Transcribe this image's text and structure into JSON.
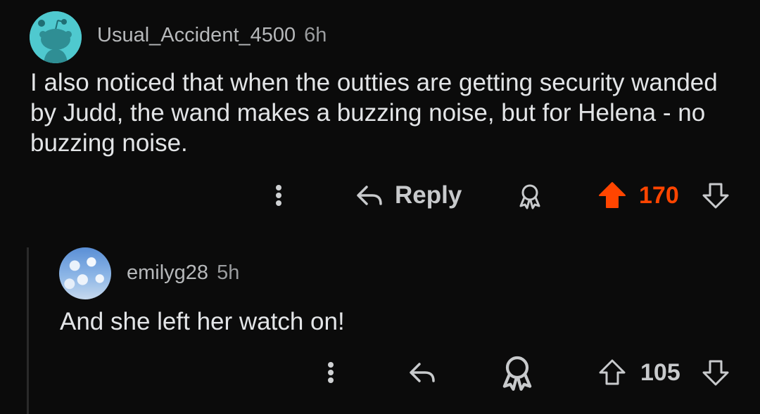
{
  "comments": [
    {
      "username": "Usual_Accident_4500",
      "time": "6h",
      "body": "I also noticed that when the outties are getting security wanded by Judd, the wand makes a buzzing noise, but for Helena - no buzzing noise.",
      "actions": {
        "more_icon": "more-vertical-icon",
        "reply_icon": "reply-arrow-icon",
        "reply_label": "Reply",
        "award_icon": "award-icon",
        "upvote_icon": "upvote-arrow-icon",
        "vote_count": "170",
        "downvote_icon": "downvote-arrow-icon",
        "upvote_active": true,
        "upvote_color": "#ff4500"
      }
    },
    {
      "username": "emilyg28",
      "time": "5h",
      "body": "And she left her watch on!",
      "actions": {
        "more_icon": "more-vertical-icon",
        "reply_icon": "reply-arrow-icon",
        "award_icon": "award-icon",
        "upvote_icon": "upvote-arrow-icon",
        "vote_count": "105",
        "downvote_icon": "downvote-arrow-icon",
        "upvote_active": false
      }
    }
  ],
  "colors": {
    "background": "#0b0b0b",
    "text": "#e3e5e7",
    "muted": "#9a9c9e",
    "upvote": "#ff4500"
  }
}
